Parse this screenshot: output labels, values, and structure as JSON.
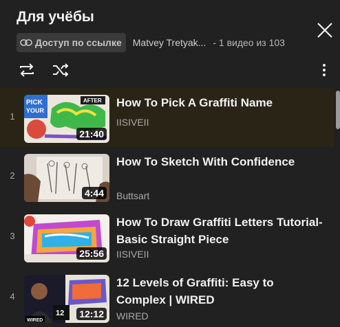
{
  "playlist": {
    "title": "Для учёбы",
    "access_label": "Доступ по ссылке",
    "owner": "Matvey Tretyak...",
    "position": "- 1 видео из 103"
  },
  "icons": {
    "close": "close-icon",
    "link": "link-icon",
    "loop": "loop-icon",
    "shuffle": "shuffle-icon",
    "more": "more-vert-icon"
  },
  "colors": {
    "background": "#212121",
    "active_row": "#2a2417",
    "badge": "#3a3a3a",
    "secondary_text": "#aaaaaa"
  },
  "videos": [
    {
      "index": "1",
      "title": "How To Pick A Graffiti Name",
      "channel": "IISIVEII",
      "duration": "21:40",
      "active": true
    },
    {
      "index": "2",
      "title": "How To Sketch With Confidence",
      "channel": "Buttsart",
      "duration": "4:44",
      "active": false
    },
    {
      "index": "3",
      "title": "How To Draw Graffiti Letters Tutorial- Basic Straight Piece",
      "channel": "IISIVEII",
      "duration": "25:56",
      "active": false
    },
    {
      "index": "4",
      "title": "12 Levels of Graffiti: Easy to Complex | WIRED",
      "channel": "WIRED",
      "duration": "12:12",
      "active": false
    }
  ]
}
